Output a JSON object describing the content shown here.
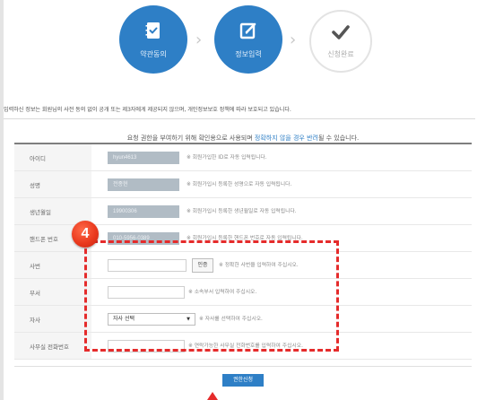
{
  "steps": [
    {
      "label": "약관동의",
      "icon": "document-check-icon"
    },
    {
      "label": "정보입력",
      "icon": "edit-icon"
    },
    {
      "label": "신청완료",
      "icon": "checkmark-icon"
    }
  ],
  "notice": "입력하신 정보는 회원님의 사전 동의 없이 공개 또는 제3자에게 제공되지 않으며, 개인정보보호 정책에 따라 보호되고 있습니다.",
  "request_note": {
    "before": "요청 권한을 부여하기 위해 확인용으로 사용되며 ",
    "highlight": "정확하지 않을 경우 반려",
    "after": "될 수 있습니다."
  },
  "fields": {
    "id": {
      "label": "아이디",
      "value": "hyun4613",
      "hint": "※ 회원가입한 ID로 자동 입력됩니다."
    },
    "name": {
      "label": "성명",
      "value": "전종현",
      "hint": "※ 회원가입시 등록한 성명으로 자동 입력됩니다."
    },
    "birth": {
      "label": "생년월일",
      "value": "19900306",
      "hint": "※ 회원가입시 등록한 생년월일로 자동 입력됩니다."
    },
    "phone": {
      "label": "핸드폰 번호",
      "value": "010-5956-0389",
      "hint": "※ 회원가입시 등록한 핸드폰 번호로 자동 입력됩니다."
    },
    "emp_no": {
      "label": "사번",
      "value": "",
      "button": "인증",
      "hint": "※ 정확한 사번을 입력하여 주십시오."
    },
    "dept": {
      "label": "부서",
      "value": "",
      "hint": "※ 소속부서 입력하여 주십시오."
    },
    "company": {
      "label": "자사",
      "selected": "자사 선택",
      "hint": "※ 자사를 선택하여 주십시오."
    },
    "office_phone": {
      "label": "사무실 전화번호",
      "value": "",
      "hint": "※ 연락가능한 사무실 전화번호를 입력하여 주십시오."
    }
  },
  "annotation": {
    "badge": "4",
    "color": "#e52b2b"
  },
  "submit_label": "권한신청",
  "colors": {
    "accent": "#2e7fc6",
    "readonly_bg": "#b1bcc5",
    "highlight": "#d9534f"
  }
}
